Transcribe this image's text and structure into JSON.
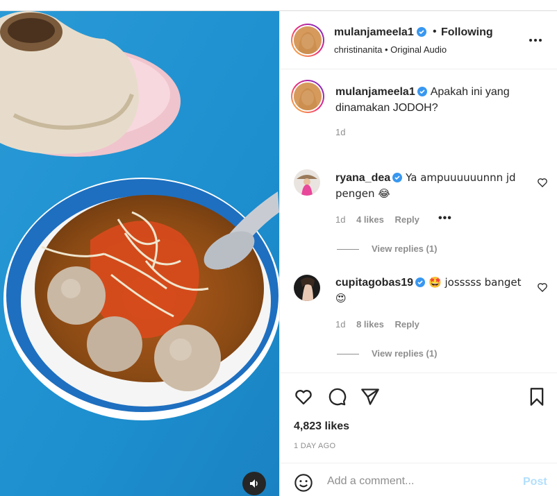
{
  "colors": {
    "accent": "#0095f6",
    "verified": "#3897f0",
    "muted": "#8e8e8e",
    "post_disabled": "#b2dffc"
  },
  "header": {
    "username": "mulanjameela1",
    "separator": "•",
    "follow_status": "Following",
    "audio_line": "christinanita • Original Audio",
    "more_icon": "more-horizontal-icon"
  },
  "caption": {
    "username": "mulanjameela1",
    "text": "Apakah ini yang dinamakan JODOH?",
    "time": "1d"
  },
  "comments": [
    {
      "username": "ryana_dea",
      "text": "Ya ampuuuuuunnn jd pengen 😂",
      "time": "1d",
      "likes": "4 likes",
      "reply_label": "Reply",
      "more": "•••",
      "view_replies": "View replies (1)"
    },
    {
      "username": "cupitagobas19",
      "text": "🤩 josssss banget 😍",
      "time": "1d",
      "likes": "8 likes",
      "reply_label": "Reply",
      "view_replies": "View replies (1)"
    }
  ],
  "actions": {
    "likes": "4,823 likes",
    "time_ago": "1 DAY AGO",
    "icons": [
      "heart-icon",
      "comment-icon",
      "share-icon",
      "bookmark-icon"
    ]
  },
  "composer": {
    "placeholder": "Add a comment...",
    "post_label": "Post",
    "emoji_icon": "emoji-icon"
  },
  "media": {
    "sound_icon": "speaker-icon"
  }
}
